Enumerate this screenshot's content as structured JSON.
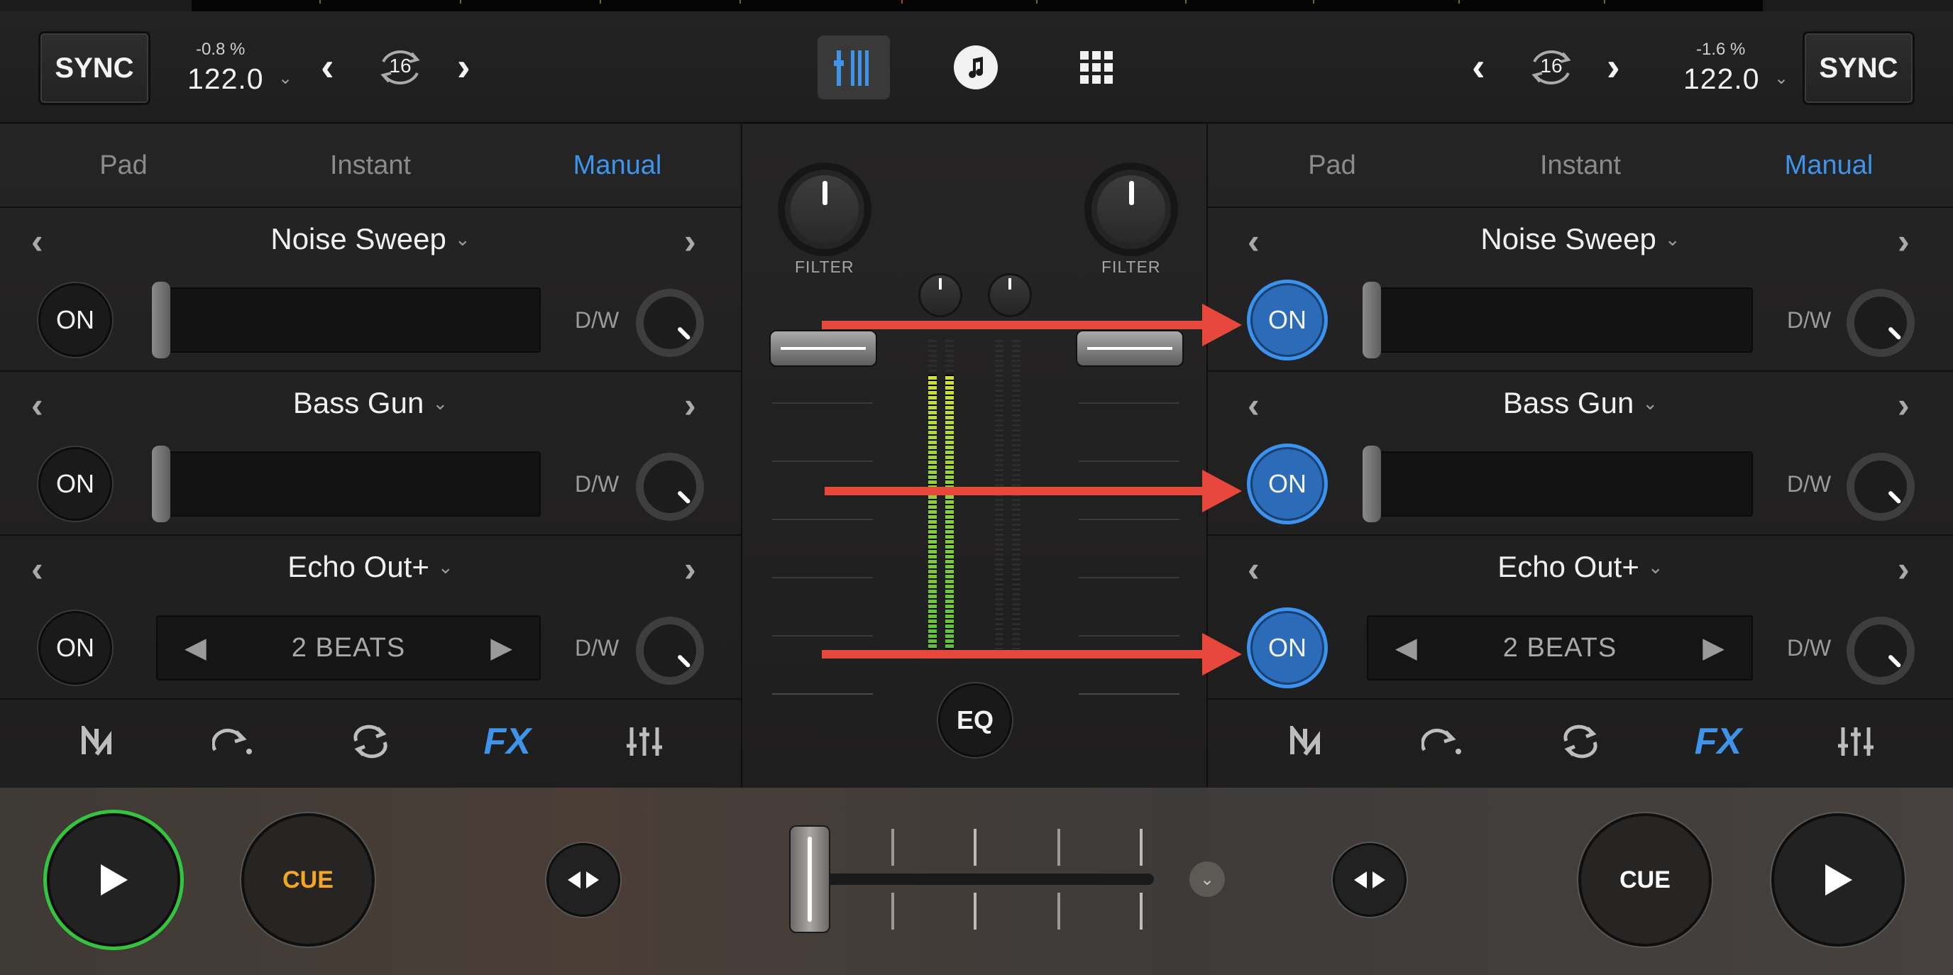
{
  "colors": {
    "accent_blue": "#3d94e8",
    "on_active": "#2b6bb8",
    "play_ring_green": "#34c43f",
    "cue_orange": "#f5a623",
    "annotation_red": "#e8473b"
  },
  "topbar": {
    "left": {
      "sync_label": "SYNC",
      "pitch": "-0.8 %",
      "bpm": "122.0",
      "loop_value": "16"
    },
    "right": {
      "sync_label": "SYNC",
      "pitch": "-1.6 %",
      "bpm": "122.0",
      "loop_value": "16"
    },
    "center_icons": [
      "mixer-view-icon",
      "music-library-icon",
      "grid-view-icon"
    ]
  },
  "left_deck": {
    "tabs": [
      {
        "label": "Pad"
      },
      {
        "label": "Instant"
      },
      {
        "label": "Manual",
        "active": true
      }
    ],
    "fx": [
      {
        "name": "Noise Sweep",
        "on_label": "ON",
        "on_active": false,
        "dw_label": "D/W",
        "control": "slider"
      },
      {
        "name": "Bass Gun",
        "on_label": "ON",
        "on_active": false,
        "dw_label": "D/W",
        "control": "slider"
      },
      {
        "name": "Echo Out+",
        "on_label": "ON",
        "on_active": false,
        "dw_label": "D/W",
        "control": "beats",
        "beats_label": "2 BEATS"
      }
    ],
    "toolbar": {
      "fx_label": "FX",
      "icons": [
        "neural-mix-icon",
        "skip-icon",
        "loop-icon",
        "fx-icon",
        "eq-sliders-icon"
      ]
    }
  },
  "right_deck": {
    "tabs": [
      {
        "label": "Pad"
      },
      {
        "label": "Instant"
      },
      {
        "label": "Manual",
        "active": true
      }
    ],
    "fx": [
      {
        "name": "Noise Sweep",
        "on_label": "ON",
        "on_active": true,
        "dw_label": "D/W",
        "control": "slider"
      },
      {
        "name": "Bass Gun",
        "on_label": "ON",
        "on_active": true,
        "dw_label": "D/W",
        "control": "slider"
      },
      {
        "name": "Echo Out+",
        "on_label": "ON",
        "on_active": true,
        "dw_label": "D/W",
        "control": "beats",
        "beats_label": "2 BEATS"
      }
    ],
    "toolbar": {
      "fx_label": "FX",
      "icons": [
        "neural-mix-icon",
        "skip-icon",
        "loop-icon",
        "fx-icon",
        "eq-sliders-icon"
      ]
    }
  },
  "mixer": {
    "filter_left_label": "FILTER",
    "filter_right_label": "FILTER",
    "eq_label": "EQ",
    "meter_left_level": 0.88,
    "meter_right_level": 0.0
  },
  "bottom": {
    "left_cue_label": "CUE",
    "right_cue_label": "CUE",
    "crossfader_position": 0.0
  }
}
